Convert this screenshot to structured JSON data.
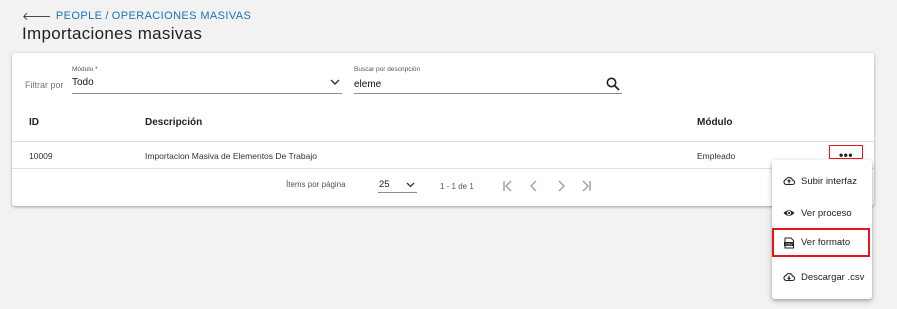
{
  "breadcrumb": {
    "back_icon": "arrow-left-icon",
    "items": [
      "PEOPLE",
      "OPERACIONES MASIVAS"
    ],
    "separator": "/"
  },
  "page_title": "Importaciones masivas",
  "filters": {
    "label": "Filtrar por",
    "modulo": {
      "label": "Módulo *",
      "value": "Todo"
    },
    "search": {
      "label": "Buscar por descripción",
      "value": "eleme"
    }
  },
  "table": {
    "columns": [
      "ID",
      "Descripción",
      "Módulo"
    ],
    "rows": [
      {
        "id": "10009",
        "descripcion": "Importacion Masiva de Elementos De Trabajo",
        "modulo": "Empleado"
      }
    ]
  },
  "paginator": {
    "items_per_page_label": "Ítems por página",
    "items_per_page": "25",
    "range": "1 - 1 de 1"
  },
  "menu": {
    "items": [
      {
        "label": "Subir interfaz",
        "icon": "cloud-upload-icon"
      },
      {
        "label": "Ver proceso",
        "icon": "eye-icon"
      },
      {
        "label": "Ver formato",
        "icon": "file-format-icon"
      },
      {
        "label": "Descargar .csv",
        "icon": "cloud-download-icon"
      }
    ]
  },
  "colors": {
    "link": "#1a73b8",
    "highlight": "#e5161b",
    "background": "#f2f2f2"
  }
}
